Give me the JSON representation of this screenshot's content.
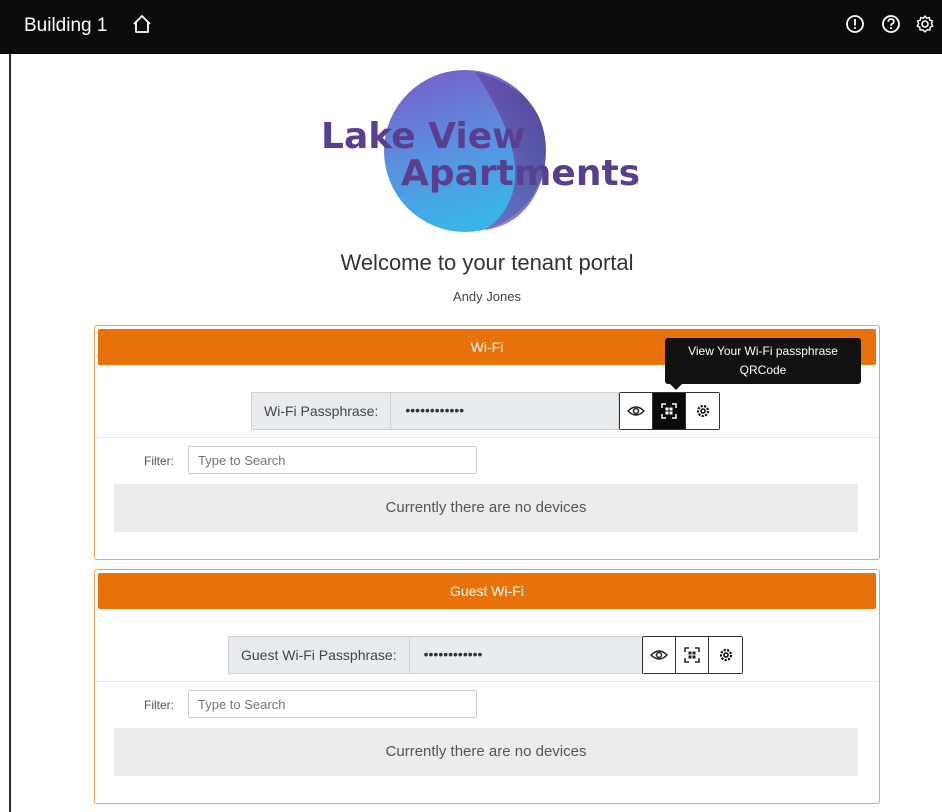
{
  "topbar": {
    "title": "Building 1",
    "icons": [
      "home-icon",
      "alert-icon",
      "help-icon",
      "settings-icon"
    ]
  },
  "logo": {
    "line1": "Lake View",
    "line2": "Apartments",
    "colors": {
      "text": "#5b3f8f",
      "circle_top": "#7a5cc4",
      "circle_bottom": "#35a6e0"
    }
  },
  "welcome": {
    "heading": "Welcome to your tenant portal",
    "user": "Andy Jones"
  },
  "wifi": {
    "title": "Wi-Fi",
    "pass_label": "Wi-Fi Passphrase:",
    "pass_value": "••••••••••••",
    "filter_label": "Filter:",
    "filter_placeholder": "Type to Search",
    "empty": "Currently there are no devices"
  },
  "guest": {
    "title": "Guest Wi-Fi",
    "pass_label": "Guest Wi-Fi Passphrase:",
    "pass_value": "••••••••••••",
    "filter_label": "Filter:",
    "filter_placeholder": "Type to Search",
    "empty": "Currently there are no devices"
  },
  "tooltip": {
    "line1": "View Your Wi-Fi passphrase",
    "line2": "QRCode"
  },
  "colors": {
    "accent": "#e8710a",
    "topbar": "#0b0b0b",
    "panel_border": "#f0a35a"
  }
}
